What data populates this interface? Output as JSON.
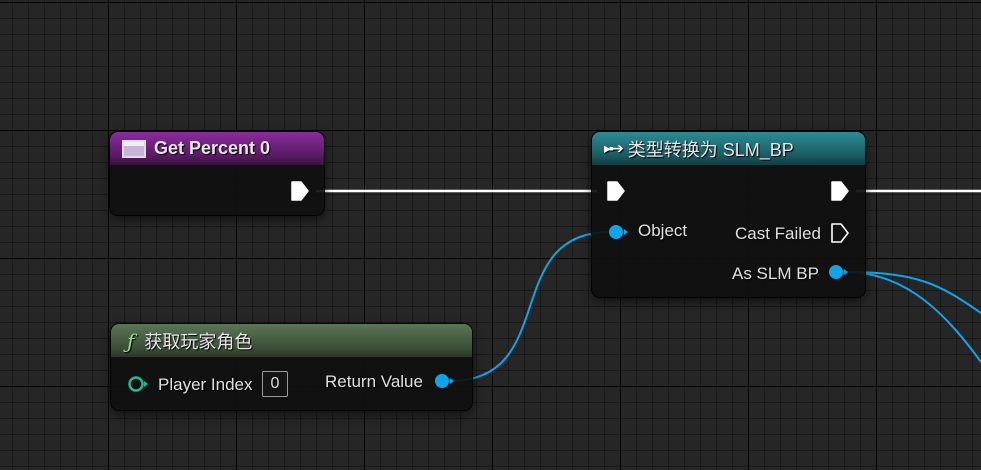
{
  "nodes": {
    "get_percent": {
      "title": "Get Percent 0",
      "icon": "variable-icon",
      "header_color": "#7a2a8a"
    },
    "cast": {
      "title": "类型转换为 SLM_BP",
      "icon": "cast-icon",
      "header_color": "#1f6c73",
      "pins": {
        "object": "Object",
        "cast_failed": "Cast Failed",
        "as_slm_bp": "As SLM BP"
      }
    },
    "get_player_character": {
      "title": "获取玩家角色",
      "icon": "function-icon",
      "header_color": "#4b6446",
      "pins": {
        "player_index": "Player Index",
        "player_index_value": "0",
        "return_value": "Return Value"
      }
    }
  },
  "colors": {
    "exec_wire": "#ffffff",
    "object_wire": "#0ea5e9",
    "int_pin": "#1fb89a",
    "background": "#262626"
  }
}
